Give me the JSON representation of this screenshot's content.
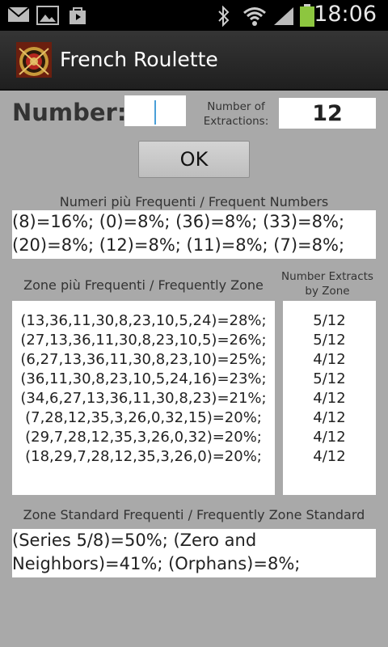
{
  "status_bar": {
    "time": "18:06",
    "icons": [
      "mail-icon",
      "image-icon",
      "store-icon",
      "bluetooth-icon",
      "wifi-icon",
      "signal-icon",
      "battery-icon"
    ],
    "battery_color": "#8dc63f"
  },
  "app": {
    "title": "French Roulette"
  },
  "form": {
    "number_label": "Number:",
    "number_value": "",
    "extractions_label": "Number of Extractions:",
    "extractions_value": "12",
    "ok_label": "OK"
  },
  "frequent_numbers": {
    "title": "Numeri più Frequenti / Frequent Numbers",
    "text": "(8)=16%; (0)=8%; (36)=8%; (33)=8%; (20)=8%; (12)=8%; (11)=8%; (7)=8%;"
  },
  "zones": {
    "title": "Zone più Frequenti / Frequently Zone",
    "extracts_title": "Number Extracts by Zone",
    "items": [
      {
        "zone": "(13,36,11,30,8,23,10,5,24)=28%;",
        "extracts": "5/12"
      },
      {
        "zone": "(27,13,36,11,30,8,23,10,5)=26%;",
        "extracts": "5/12"
      },
      {
        "zone": "(6,27,13,36,11,30,8,23,10)=25%;",
        "extracts": "4/12"
      },
      {
        "zone": "(36,11,30,8,23,10,5,24,16)=23%;",
        "extracts": "5/12"
      },
      {
        "zone": "(34,6,27,13,36,11,30,8,23)=21%;",
        "extracts": "4/12"
      },
      {
        "zone": "(7,28,12,35,3,26,0,32,15)=20%;",
        "extracts": "4/12"
      },
      {
        "zone": "(29,7,28,12,35,3,26,0,32)=20%;",
        "extracts": "4/12"
      },
      {
        "zone": "(18,29,7,28,12,35,3,26,0)=20%;",
        "extracts": "4/12"
      }
    ]
  },
  "standard_zones": {
    "title": "Zone Standard Frequenti / Frequently Zone Standard",
    "text": "(Series 5/8)=50%; (Zero and Neighbors)=41%; (Orphans)=8%;"
  }
}
